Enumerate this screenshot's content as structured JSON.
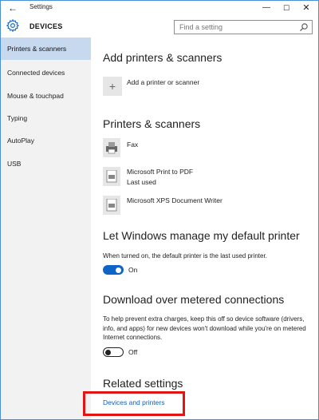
{
  "window": {
    "title": "Settings",
    "back_glyph": "←",
    "minimize_glyph": "—",
    "maximize_glyph": "☐",
    "close_glyph": "✕"
  },
  "header": {
    "icon": "gear-icon",
    "title": "DEVICES",
    "search_placeholder": "Find a setting"
  },
  "sidebar": {
    "items": [
      {
        "label": "Printers & scanners",
        "active": true
      },
      {
        "label": "Connected devices",
        "active": false
      },
      {
        "label": "Mouse & touchpad",
        "active": false
      },
      {
        "label": "Typing",
        "active": false
      },
      {
        "label": "AutoPlay",
        "active": false
      },
      {
        "label": "USB",
        "active": false
      }
    ]
  },
  "main": {
    "add_section": {
      "title": "Add printers & scanners",
      "add_label": "Add a printer or scanner",
      "add_glyph": "+"
    },
    "printers_section": {
      "title": "Printers & scanners",
      "printers": [
        {
          "name": "Fax",
          "sub": ""
        },
        {
          "name": "Microsoft Print to PDF",
          "sub": "Last used"
        },
        {
          "name": "Microsoft XPS Document Writer",
          "sub": ""
        }
      ]
    },
    "default_printer": {
      "title": "Let Windows manage my default printer",
      "description": "When turned on, the default printer is the last used printer.",
      "toggle_state": "On"
    },
    "metered": {
      "title": "Download over metered connections",
      "description": "To help prevent extra charges, keep this off so device software (drivers, info, and apps) for new devices won't download while you're on metered Internet connections.",
      "toggle_state": "Off"
    },
    "related": {
      "title": "Related settings",
      "link": "Devices and printers"
    }
  },
  "colors": {
    "accent": "#0f65c5",
    "sidebar_active": "#c7d9ee",
    "highlight": "#e21414",
    "link": "#0f5fb8"
  }
}
